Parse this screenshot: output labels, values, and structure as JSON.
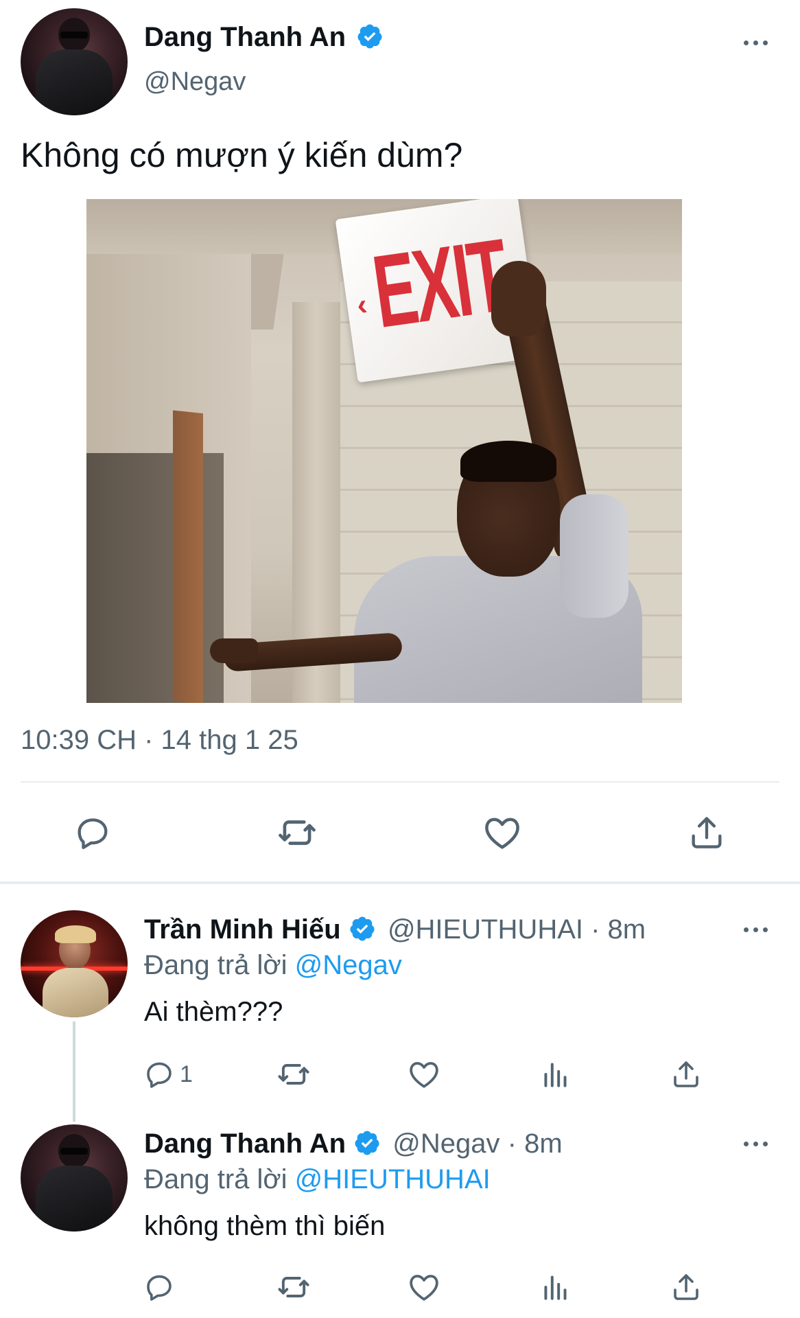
{
  "main_tweet": {
    "author_name": "Dang Thanh An",
    "author_handle": "@Negav",
    "text": "Không có mượn ý kiến dùm?",
    "meme_sign_text": "EXIT",
    "meta": "10:39 CH · 14 thg 1 25"
  },
  "replies": [
    {
      "author_name": "Trần Minh Hiếu",
      "author_handle": "@HIEUTHUHAI · 8m",
      "replying_prefix": "Đang trả lời",
      "replying_to": "@Negav",
      "text": "Ai thèm???",
      "reply_count": "1"
    },
    {
      "author_name": "Dang Thanh An",
      "author_handle": "@Negav · 8m",
      "replying_prefix": "Đang trả lời",
      "replying_to": "@HIEUTHUHAI",
      "text": "không thèm thì biến",
      "reply_count": ""
    }
  ],
  "icons": {
    "verified": "verified-badge-icon",
    "more": "more-horizontal-icon",
    "reply": "reply-icon",
    "retweet": "retweet-icon",
    "like": "heart-icon",
    "views": "views-icon",
    "share": "share-icon"
  },
  "colors": {
    "accent": "#1d9bf0",
    "text": "#0f1419",
    "muted": "#536471",
    "divider": "#e6ecf0",
    "exit_red": "#d8313a"
  }
}
